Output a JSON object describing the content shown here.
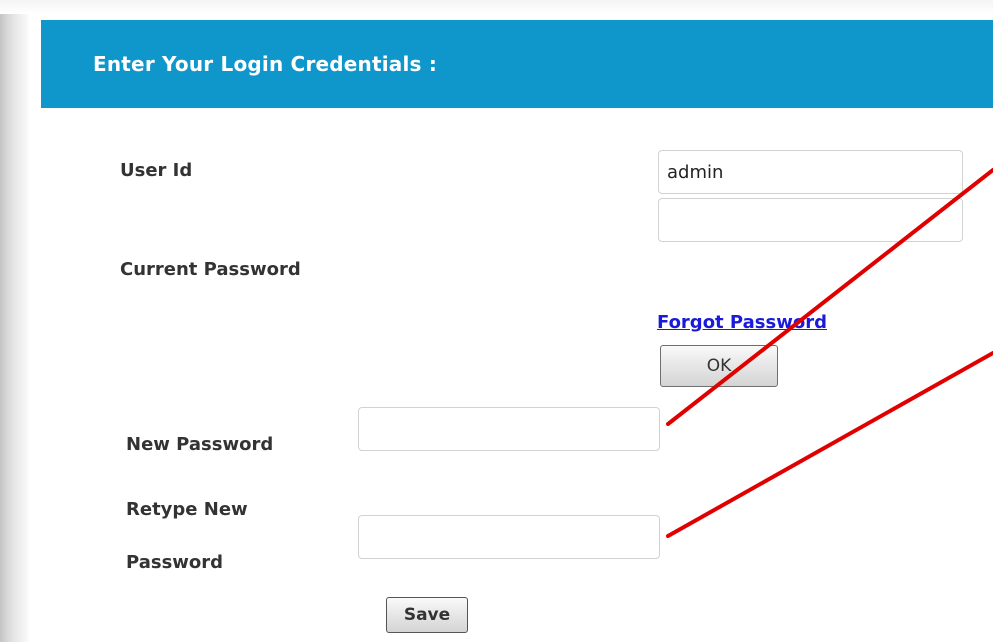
{
  "form": {
    "title": "Enter Your Login Credentials :",
    "user_id_label": "User Id",
    "user_id_value": "admin",
    "current_password_label": "Current Password",
    "current_password_value": "",
    "forgot_password_link": "Forgot Password",
    "ok_button": "OK",
    "new_password_label": "New Password",
    "new_password_value": "",
    "retype_label_line1": "Retype New",
    "retype_label_line2": "Password",
    "retype_password_value": "",
    "save_button": "Save"
  },
  "colors": {
    "header_background": "#0f97cc",
    "header_text": "#ffffff",
    "link": "#1a1adb",
    "annotation_line": "#e00000"
  }
}
